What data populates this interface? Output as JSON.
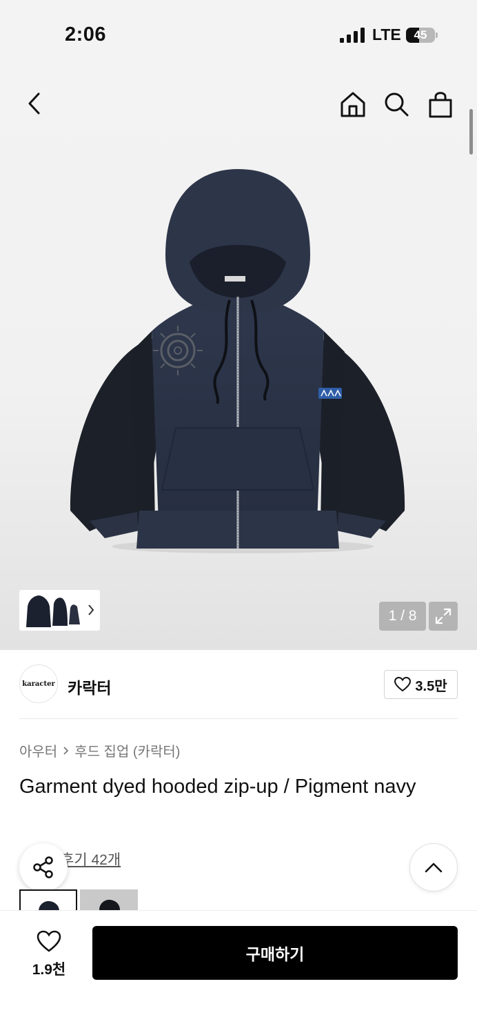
{
  "status": {
    "time": "2:06",
    "network": "LTE",
    "battery": "45",
    "battery_level": 0.45
  },
  "nav": {
    "icons": [
      "back-icon",
      "home-icon",
      "search-icon",
      "shopping-bag-icon"
    ]
  },
  "gallery": {
    "counter": "1 / 8",
    "current": 1,
    "total": 8
  },
  "brand": {
    "logo_text": "karacter",
    "name": "카락터",
    "likes": "3.5만"
  },
  "breadcrumb": {
    "category": "아우터",
    "subcategory": "후드 집업 (카락터)"
  },
  "product": {
    "title": "Garment dyed hooded zip-up / Pigment navy",
    "review_link": "후기 42개"
  },
  "bottom": {
    "wish_count": "1.9천",
    "buy_label": "구매하기"
  },
  "colors": {
    "navy": "#2b3347",
    "black": "#1a1d24",
    "accent": "#000000"
  }
}
